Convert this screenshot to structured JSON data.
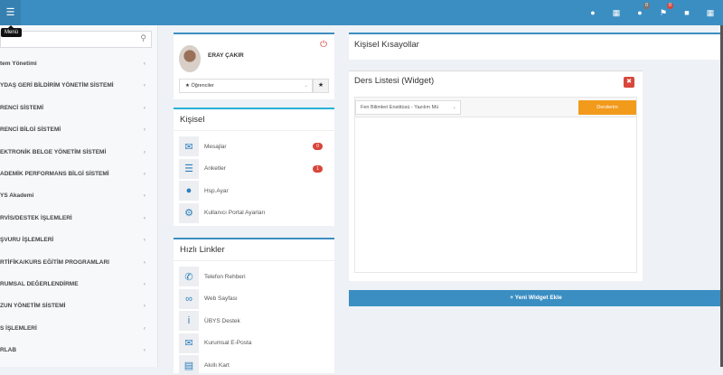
{
  "topbar": {
    "menu_tooltip": "Menü",
    "icons": [
      "globe-icon",
      "calendar-icon",
      "chat-icon",
      "flag-icon",
      "lock-icon",
      "grid-icon"
    ],
    "chat_badge": "0",
    "flag_badge": "0"
  },
  "sidebar": {
    "search_placeholder": "",
    "items": [
      "tem Yönetimi",
      "YDAŞ GERİ BİLDİRİM YÖNETİM SİSTEMİ",
      "RENCİ SİSTEMİ",
      "RENCİ BİLGİ SİSTEMİ",
      "EKTRONİK BELGE YÖNETİM SİSTEMİ",
      "ADEMİK PERFORMANS BİLGİ SİSTEMİ",
      "YS Akademi",
      "RVİS/DESTEK İŞLEMLERİ",
      "ŞVURU İŞLEMLERİ",
      "RTİFİKA/KURS EĞİTİM PROGRAMLARI",
      "RUMSAL DEĞERLENDİRME",
      "ZUN YÖNETİM SİSTEMİ",
      "S İŞLEMLERİ",
      "RLAB"
    ]
  },
  "profile": {
    "name": "ERAY ÇAKIR",
    "role_select": "★ Öğrenciler"
  },
  "personal": {
    "title": "Kişisel",
    "items": [
      {
        "label": "Mesajlar",
        "badge": "0"
      },
      {
        "label": "Anketler",
        "badge": "1"
      },
      {
        "label": "Hsp.Ayar"
      },
      {
        "label": "Kullanıcı Portal Ayarları"
      }
    ]
  },
  "quick_links": {
    "title": "Hızlı Linkler",
    "items": [
      "Telefon Rehberi",
      "Web Sayfası",
      "ÜBYS Destek",
      "Kurumsal E-Posta",
      "Akıllı Kart"
    ]
  },
  "shortcuts": {
    "title": "Kişisel Kısayollar"
  },
  "course_widget": {
    "title": "Ders Listesi (Widget)",
    "select": "Fen Bilimleri Enstitüsü - Yazılım Mü",
    "button": "Derslerim"
  },
  "add_widget": {
    "label": "+ Yeni Widget Ekle"
  }
}
